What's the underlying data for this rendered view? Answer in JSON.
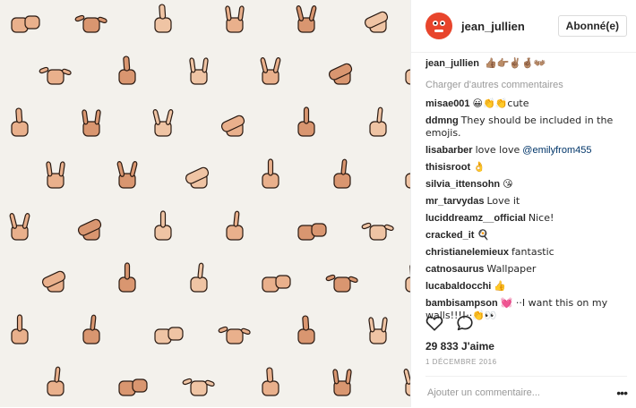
{
  "header": {
    "username": "jean_jullien",
    "follow_label": "Abonné(e)"
  },
  "caption": {
    "username": "jean_jullien",
    "text": "👍🏽👉🏽✌🏽🤞🏽👐🏽"
  },
  "load_more_label": "Charger d'autres commentaires",
  "comments": [
    {
      "user": "misae001",
      "text": "😀👏👏cute"
    },
    {
      "user": "ddmng",
      "text": "They should be included in the emojis."
    },
    {
      "user": "lisabarber",
      "text": "love love",
      "mention": "@emilyfrom455"
    },
    {
      "user": "thisisroot",
      "text": "👌"
    },
    {
      "user": "silvia_ittensohn",
      "text": "😘"
    },
    {
      "user": "mr_tarvydas",
      "text": "Love it"
    },
    {
      "user": "luciddreamz__official",
      "text": "Nice!"
    },
    {
      "user": "cracked_it",
      "text": "🍳"
    },
    {
      "user": "christianelemieux",
      "text": "fantastic"
    },
    {
      "user": "catnosaurus",
      "text": "Wallpaper"
    },
    {
      "user": "lucabaldocchi",
      "text": "👍"
    },
    {
      "user": "bambisampson",
      "text": "💓 ··I want this on my walls!!!!··👏👀"
    }
  ],
  "likes_label": "29 833 J'aime",
  "date_label": "1 DÉCEMBRE 2016",
  "add_comment_placeholder": "Ajouter un commentaire...",
  "icons": {
    "like": "heart-icon",
    "comment": "comment-icon",
    "more": "more-options-icon"
  }
}
